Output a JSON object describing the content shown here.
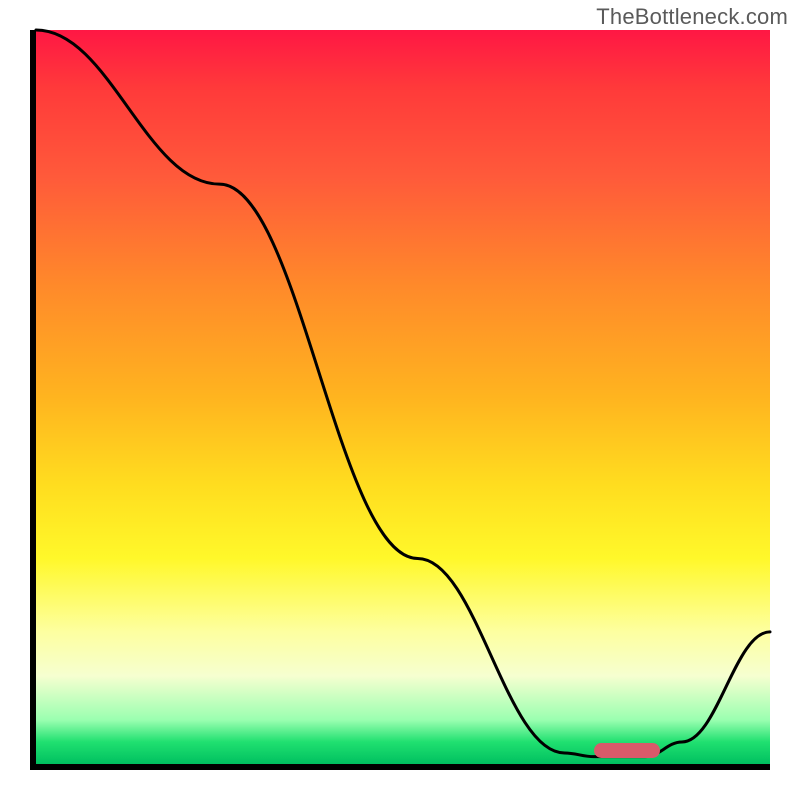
{
  "watermark": "TheBottleneck.com",
  "colors": {
    "curve": "#000000",
    "marker": "#d85a6a",
    "axes": "#000000"
  },
  "chart_data": {
    "type": "line",
    "title": "",
    "xlabel": "",
    "ylabel": "",
    "x": [
      0.0,
      0.25,
      0.52,
      0.72,
      0.76,
      0.83,
      0.88,
      1.0
    ],
    "y": [
      1.0,
      0.79,
      0.28,
      0.015,
      0.01,
      0.01,
      0.03,
      0.18
    ],
    "ylim": [
      0,
      1
    ],
    "marker": {
      "x_start": 0.76,
      "x_end": 0.85,
      "y": 0.008,
      "thickness": 0.02
    },
    "gradient_stops": [
      {
        "pos": 0.0,
        "color": "#ff1744"
      },
      {
        "pos": 0.5,
        "color": "#ffdd1f"
      },
      {
        "pos": 0.82,
        "color": "#fdffa0"
      },
      {
        "pos": 1.0,
        "color": "#00c060"
      }
    ]
  }
}
